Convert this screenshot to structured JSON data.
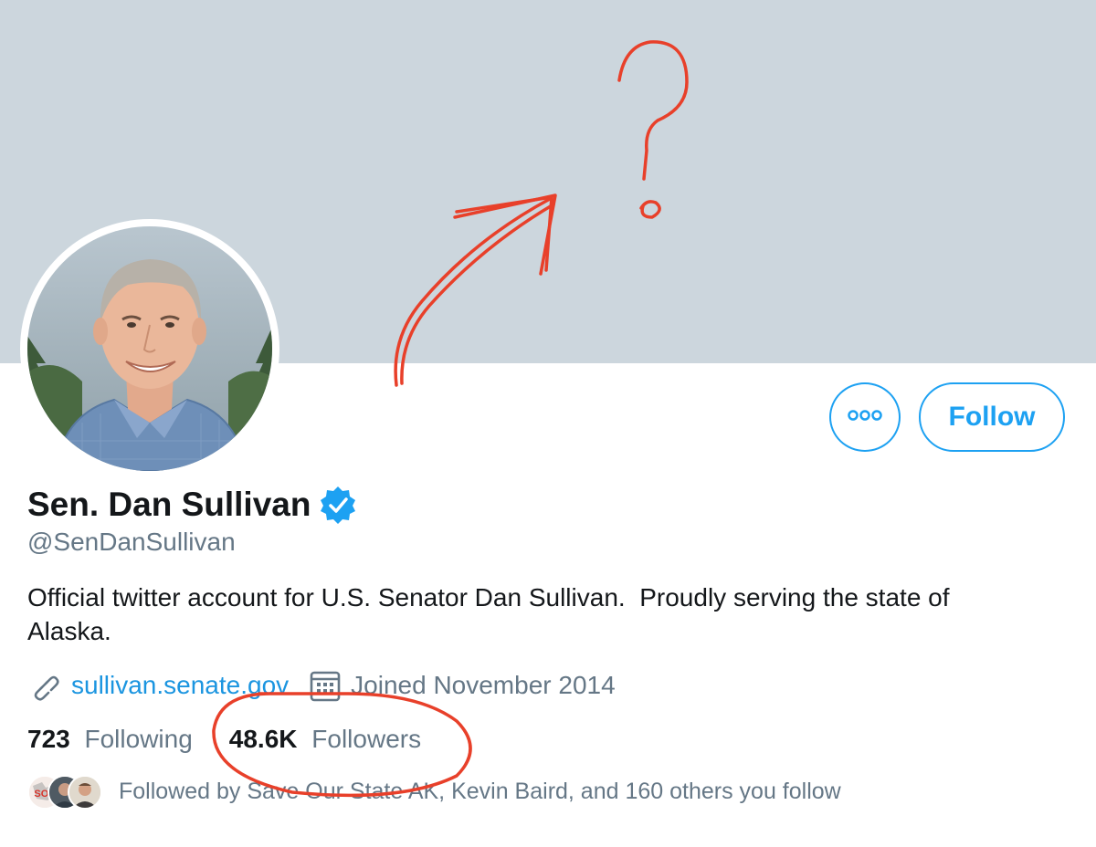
{
  "profile": {
    "display_name": "Sen. Dan Sullivan",
    "handle": "@SenDanSullivan",
    "bio": "Official twitter account for U.S. Senator Dan Sullivan.  Proudly serving the state of\nAlaska.",
    "website": "sullivan.senate.gov",
    "joined": "Joined November 2014",
    "verified": true
  },
  "actions": {
    "more_label": "More",
    "follow_label": "Follow"
  },
  "stats": {
    "following_count": "723",
    "following_label": "Following",
    "followers_count": "48.6K",
    "followers_label": "Followers"
  },
  "followed_by": {
    "text": "Followed by Save Our State AK, Kevin Baird, and 160 others you follow",
    "mini_avatar_label": "SOS"
  },
  "colors": {
    "banner": "#ccd6dd",
    "accent": "#1da1f2",
    "link": "#1b95e0",
    "secondary_text": "#657786",
    "annotation": "#e8402a"
  },
  "icons": {
    "website": "link-icon",
    "joined": "calendar-icon",
    "verified": "verified-badge-icon",
    "more": "more-dots-icon"
  }
}
